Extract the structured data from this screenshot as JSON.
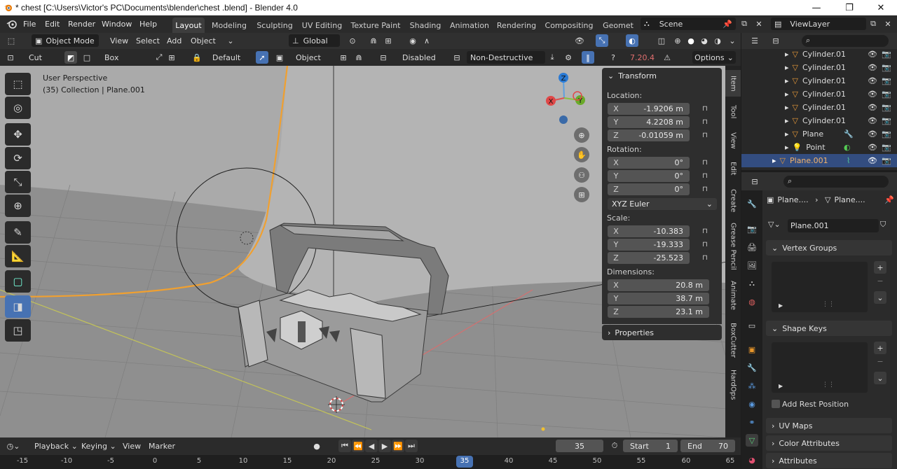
{
  "window": {
    "title": "* chest  [C:\\Users\\Victor's PC\\Documents\\blender\\chest .blend] - Blender 4.0",
    "minimize": "—",
    "maximize": "❐",
    "close": "✕"
  },
  "menu": [
    "File",
    "Edit",
    "Render",
    "Window",
    "Help"
  ],
  "workspaces": [
    "Layout",
    "Modeling",
    "Sculpting",
    "UV Editing",
    "Texture Paint",
    "Shading",
    "Animation",
    "Rendering",
    "Compositing",
    "Geomet"
  ],
  "scene": "Scene",
  "view_layer": "ViewLayer",
  "header": {
    "mode": "Object Mode",
    "view": "View",
    "select": "Select",
    "add": "Add",
    "object": "Object",
    "orientation": "Global"
  },
  "tool_header": {
    "tool": "Cut",
    "shape": "Box",
    "layer": "Default",
    "target": "Object",
    "snap": "Disabled",
    "mode": "Non-Destructive",
    "version": "7.20.4",
    "options": "Options"
  },
  "viewport": {
    "perspective": "User Perspective",
    "collection": "(35) Collection | Plane.001",
    "colors": {
      "bg": "#aaaaaa",
      "grid": "#8e8e8e",
      "x_axis": "#d47070",
      "y_axis": "#c2c25a",
      "selection": "#f0a030"
    },
    "gizmo": {
      "z": "Z",
      "y": "Y",
      "x": "X"
    }
  },
  "transform_panel": {
    "title": "Transform",
    "location_label": "Location:",
    "location": {
      "x": "-1.9206 m",
      "y": "4.2208 m",
      "z": "-0.01059 m"
    },
    "rotation_label": "Rotation:",
    "rotation": {
      "x": "0°",
      "y": "0°",
      "z": "0°"
    },
    "rotation_mode": "XYZ Euler",
    "scale_label": "Scale:",
    "scale": {
      "x": "-10.383",
      "y": "-19.333",
      "z": "-25.523"
    },
    "dimensions_label": "Dimensions:",
    "dimensions": {
      "x": "20.8 m",
      "y": "38.7 m",
      "z": "23.1 m"
    },
    "axis_x": "X",
    "axis_y": "Y",
    "axis_z": "Z",
    "properties": "Properties"
  },
  "sidebar_tabs": [
    "Item",
    "Tool",
    "View",
    "Edit",
    "Create",
    "Grease Pencil",
    "Animate",
    "BoxCutter",
    "HardOps"
  ],
  "outliner": {
    "items": [
      "Cylinder.01",
      "Cylinder.01",
      "Cylinder.01",
      "Cylinder.01",
      "Cylinder.01",
      "Cylinder.01",
      "Plane",
      "Point",
      "Plane.001"
    ]
  },
  "properties": {
    "breadcrumb_object": "Plane....",
    "breadcrumb_data": "Plane....",
    "data_name": "Plane.001",
    "vertex_groups": "Vertex Groups",
    "shape_keys": "Shape Keys",
    "add_rest_position": "Add Rest Position",
    "uv_maps": "UV Maps",
    "color_attributes": "Color Attributes",
    "attributes": "Attributes"
  },
  "timeline": {
    "playback": "Playback",
    "keying": "Keying",
    "view": "View",
    "marker": "Marker",
    "current_frame": "35",
    "start_label": "Start",
    "start": "1",
    "end_label": "End",
    "end": "70",
    "ticks": [
      "-15",
      "-10",
      "-5",
      "0",
      "5",
      "10",
      "15",
      "20",
      "25",
      "30",
      "35",
      "40",
      "45",
      "50",
      "55",
      "60",
      "65"
    ]
  }
}
